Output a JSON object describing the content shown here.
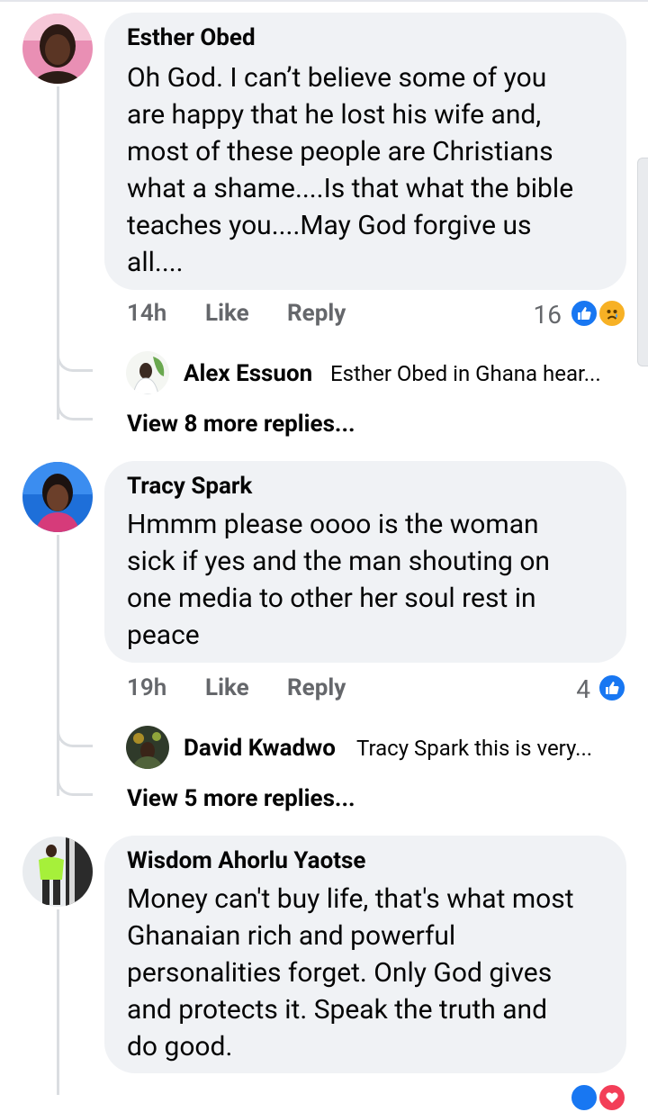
{
  "comments": [
    {
      "author": "Esther Obed",
      "lines": [
        "Oh God. I can’t believe some of you",
        "are happy that he lost his wife and,",
        "most of these people are Christians",
        "what a shame....Is that what the bible",
        "teaches you....May God forgive us",
        "all...."
      ],
      "time": "14h",
      "like_label": "Like",
      "reply_label": "Reply",
      "reaction_count": "16",
      "reactions": [
        "like-icon",
        "sad-icon"
      ],
      "reply_preview": {
        "author": "Alex Essuon",
        "text": "Esther Obed in Ghana hear..."
      },
      "more_replies": "View 8 more replies..."
    },
    {
      "author": "Tracy Spark",
      "lines": [
        "Hmmm please oooo is the woman",
        "sick if yes and the man shouting on",
        "one media to other  her soul rest in",
        "peace"
      ],
      "time": "19h",
      "like_label": "Like",
      "reply_label": "Reply",
      "reaction_count": "4",
      "reactions": [
        "like-icon"
      ],
      "reply_preview": {
        "author": "David Kwadwo",
        "text": "Tracy Spark this is very..."
      },
      "more_replies": "View 5 more replies..."
    },
    {
      "author": "Wisdom Ahorlu Yaotse",
      "lines": [
        "Money can't buy life, that's what most",
        "Ghanaian rich and powerful",
        "personalities forget. Only God gives",
        "and protects it. Speak the truth and",
        "do good."
      ],
      "reactions": [
        "like-icon",
        "love-icon"
      ]
    }
  ],
  "colors": {
    "bubble": "#f0f2f5",
    "meta": "#65676b",
    "like": "#1877f2",
    "sad": "#f7b125",
    "love": "#f33e58"
  }
}
